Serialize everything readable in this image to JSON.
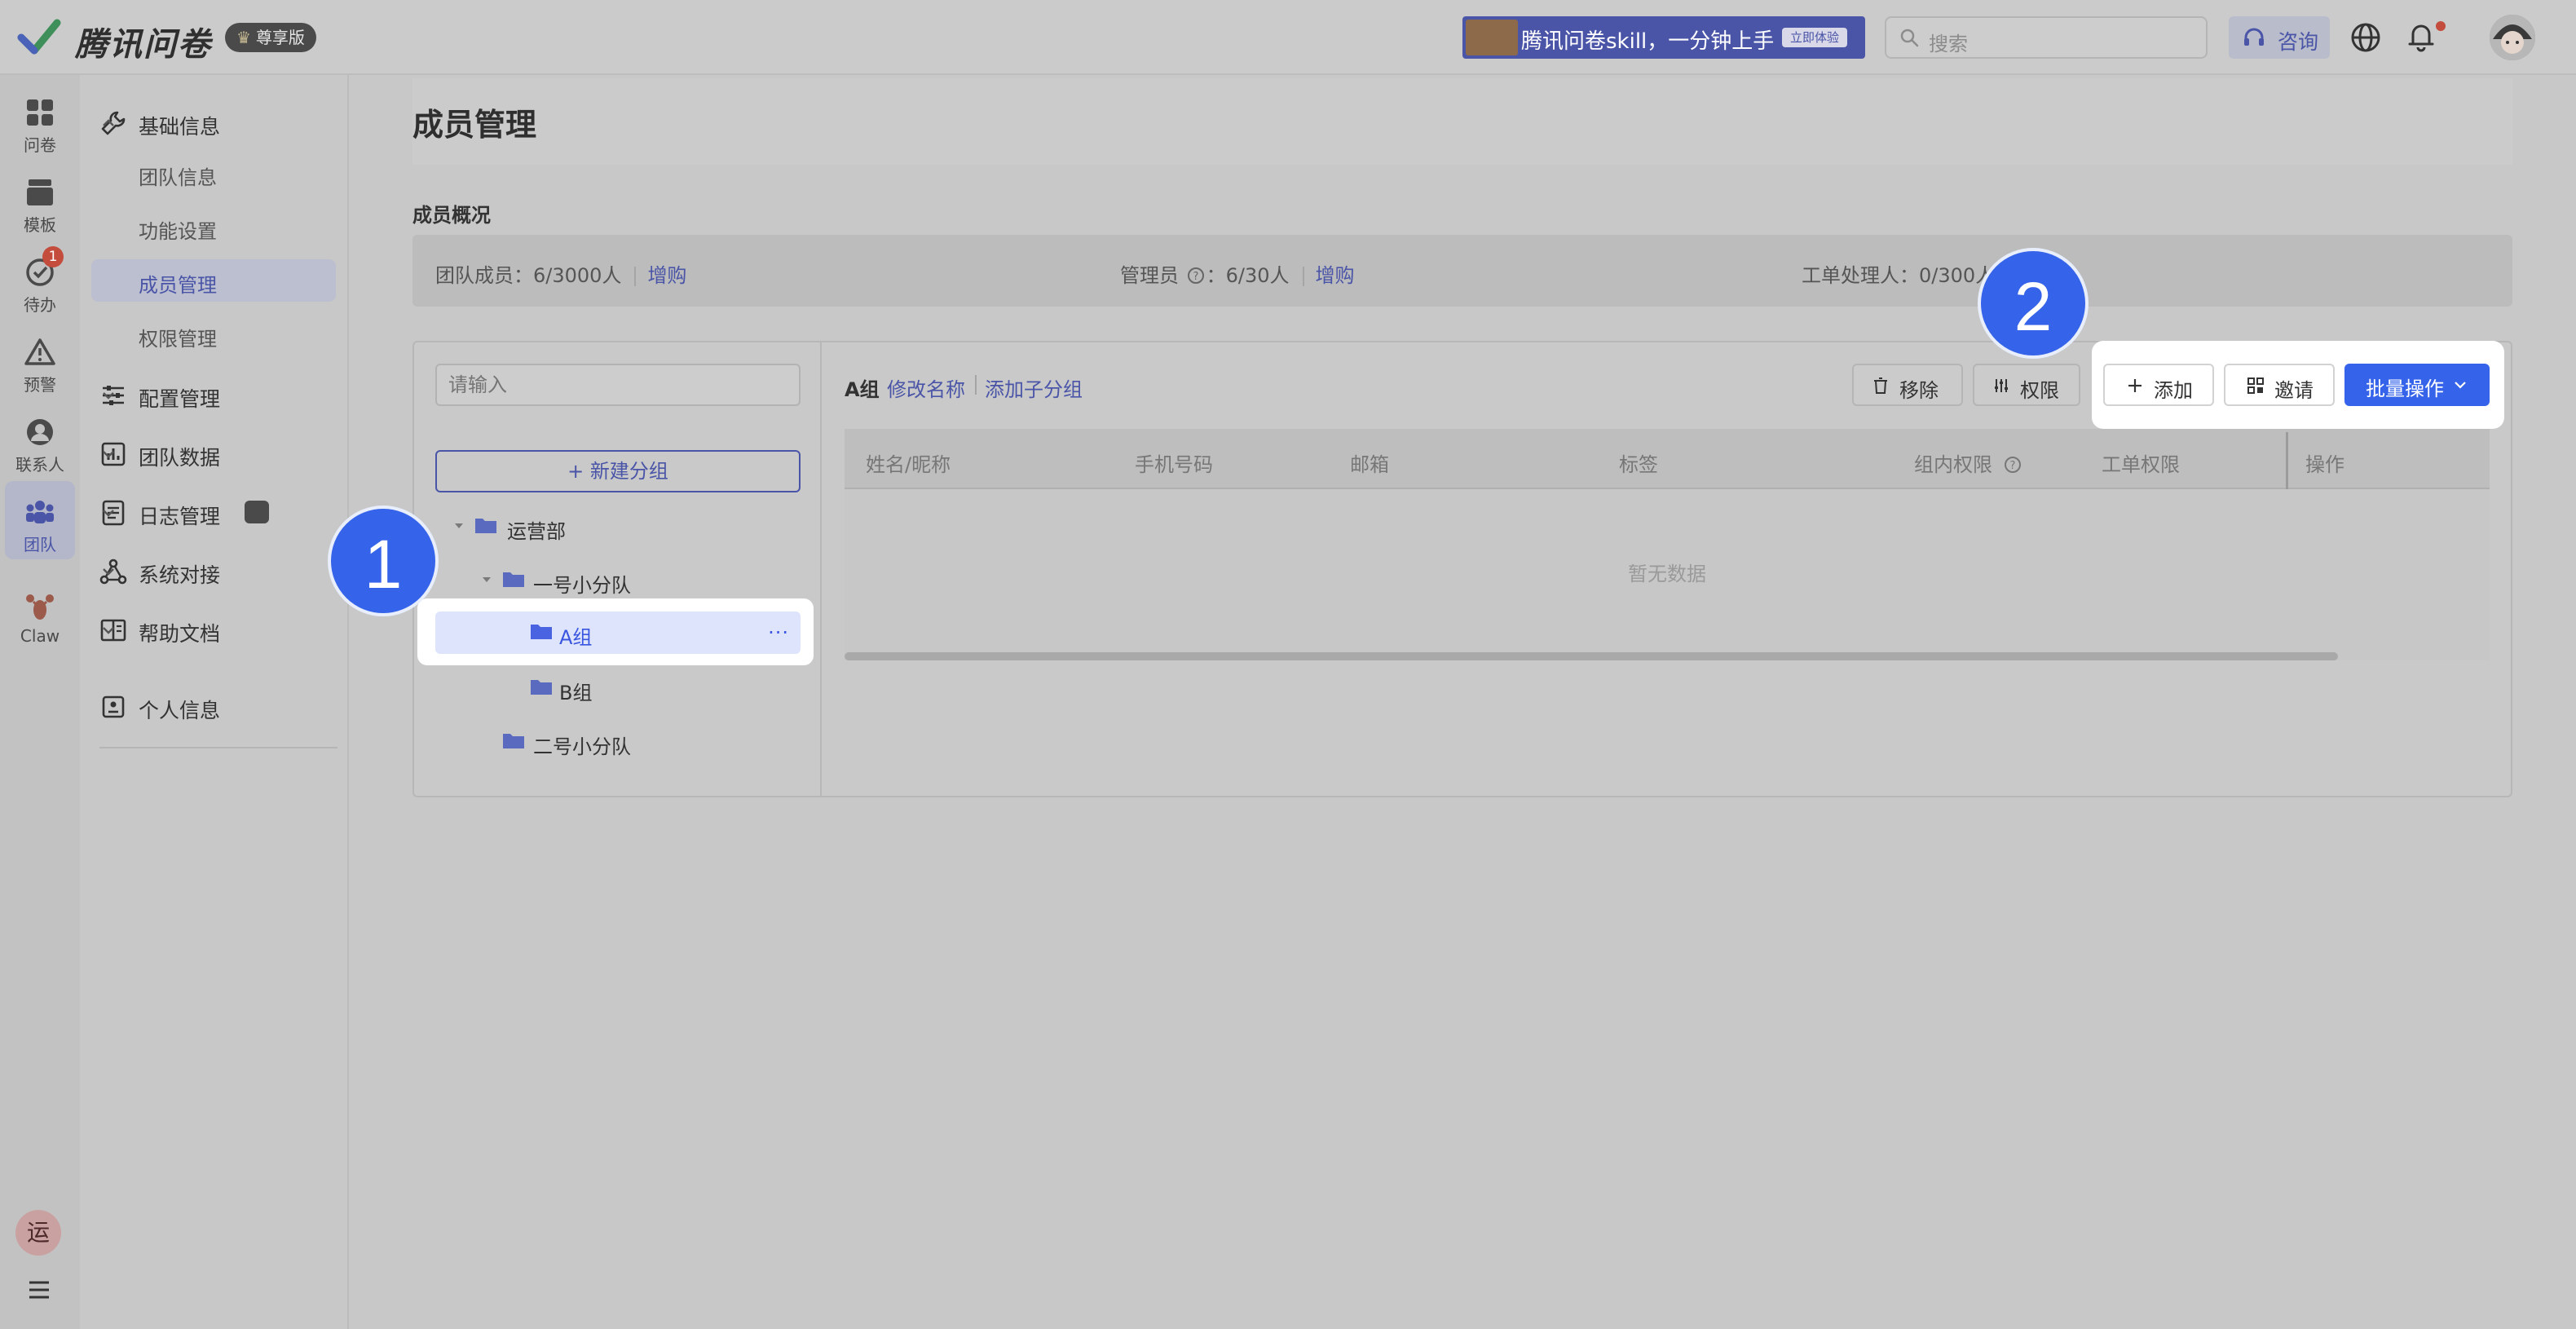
{
  "header": {
    "app_name": "腾讯问卷",
    "edition": "尊享版",
    "promo_text": "腾讯问卷skill，一分钟上手",
    "promo_tag": "立即体验",
    "search_placeholder": "搜索",
    "consult_label": "咨询"
  },
  "rail": {
    "items": [
      {
        "label": "问卷",
        "icon": "grid-icon"
      },
      {
        "label": "模板",
        "icon": "template-icon"
      },
      {
        "label": "待办",
        "icon": "check-circle-icon",
        "badge": "1"
      },
      {
        "label": "预警",
        "icon": "warning-icon"
      },
      {
        "label": "联系人",
        "icon": "contact-icon"
      },
      {
        "label": "团队",
        "icon": "team-icon",
        "active": true
      },
      {
        "label": "Claw",
        "icon": "lobster-icon"
      }
    ],
    "user_initial": "运"
  },
  "sidebar": {
    "groups": [
      {
        "label": "基础信息",
        "expanded": true,
        "children": [
          "团队信息",
          "功能设置",
          "成员管理",
          "权限管理"
        ],
        "active_child": "成员管理"
      },
      {
        "label": "配置管理",
        "expanded": false
      },
      {
        "label": "团队数据",
        "expanded": false
      },
      {
        "label": "日志管理",
        "expanded": false
      },
      {
        "label": "系统对接",
        "expanded": false
      },
      {
        "label": "帮助文档",
        "expanded": false
      }
    ],
    "personal": "个人信息"
  },
  "main": {
    "title": "成员管理",
    "overview_label": "成员概况",
    "overview": {
      "members": "团队成员：6/3000人",
      "members_link": "增购",
      "admins_label": "管理员",
      "admins_value": "：6/30人",
      "admins_link": "增购",
      "handlers": "工单处理人：0/300人"
    },
    "tree": {
      "search_placeholder": "请输入",
      "new_group": "+ 新建分组",
      "nodes": [
        "运营部",
        "一号小分队",
        "A组",
        "B组",
        "二号小分队"
      ],
      "selected": "A组",
      "more": "···"
    },
    "pane": {
      "group_name": "A组",
      "rename": "修改名称",
      "add_subgroup": "添加子分组",
      "remove": "移除",
      "permissions": "权限",
      "add": "添加",
      "invite": "邀请",
      "batch": "批量操作"
    },
    "table": {
      "columns": [
        "姓名/昵称",
        "手机号码",
        "邮箱",
        "标签",
        "组内权限",
        "工单权限",
        "操作"
      ],
      "empty": "暂无数据"
    }
  },
  "annotations": {
    "step1": "1",
    "step2": "2"
  },
  "colors": {
    "accent": "#3563e9",
    "link": "#4a55a8",
    "badge_red": "#c34c3d",
    "selected_bg": "#dde4fb"
  }
}
